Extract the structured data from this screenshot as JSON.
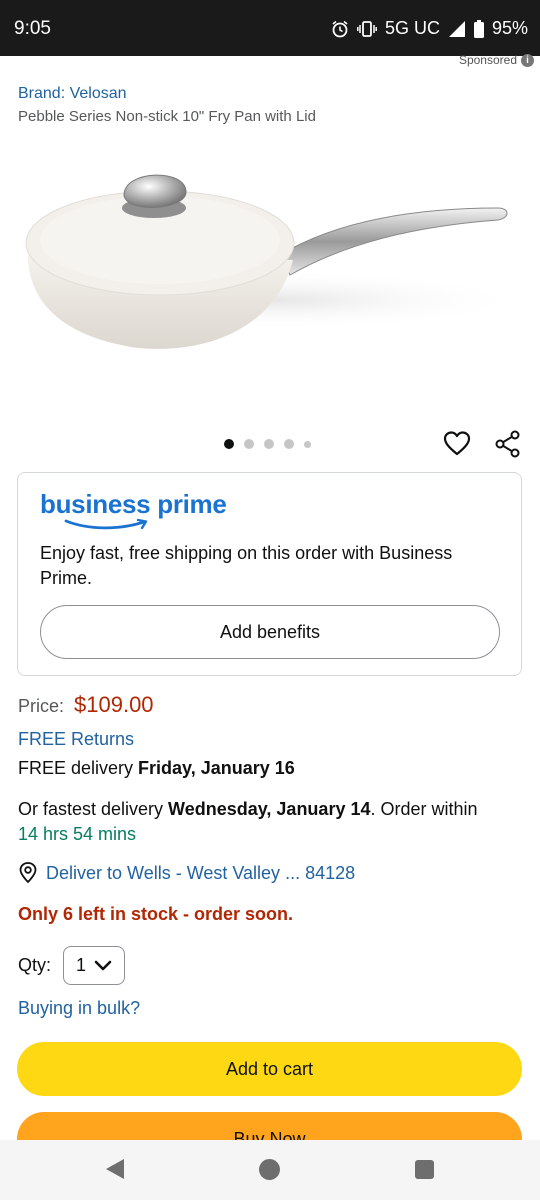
{
  "status_bar": {
    "time": "9:05",
    "network": "5G UC",
    "battery": "95%",
    "icons": [
      "alarm-icon",
      "vibrate-icon",
      "signal-icon",
      "battery-icon"
    ]
  },
  "sponsored": {
    "label": "Sponsored",
    "info_icon": "i"
  },
  "product": {
    "brand": "Brand: Velosan",
    "title": "Pebble Series Non-stick 10\" Fry Pan with Lid",
    "image_alt": "cream colored fry pan with lid",
    "carousel": {
      "total": 5,
      "active_index": 0
    }
  },
  "prime": {
    "logo_text": "business prime",
    "message": "Enjoy fast, free shipping on this order with Business Prime.",
    "button_label": "Add benefits"
  },
  "pricing": {
    "label": "Price:",
    "value": "$109.00",
    "returns": "FREE Returns"
  },
  "delivery": {
    "free_prefix": "FREE delivery ",
    "free_date": "Friday, January 16",
    "fastest_prefix": "Or fastest delivery ",
    "fastest_date": "Wednesday, January 14",
    "order_within": ". Order within ",
    "countdown": "14 hrs 54 mins",
    "deliver_to": "Deliver to Wells - West Valley ... 84128"
  },
  "stock": "Only 6 left in stock - order soon.",
  "quantity": {
    "label": "Qty:",
    "value": "1"
  },
  "bulk_link": "Buying in bulk?",
  "buttons": {
    "add_to_cart": "Add to cart",
    "buy_now": "Buy Now"
  },
  "colors": {
    "link": "#2162a1",
    "price": "#b12704",
    "add_to_cart": "#ffd814",
    "buy_now": "#ffa41c",
    "prime_blue": "#1a73d1",
    "teal": "#067d62"
  }
}
